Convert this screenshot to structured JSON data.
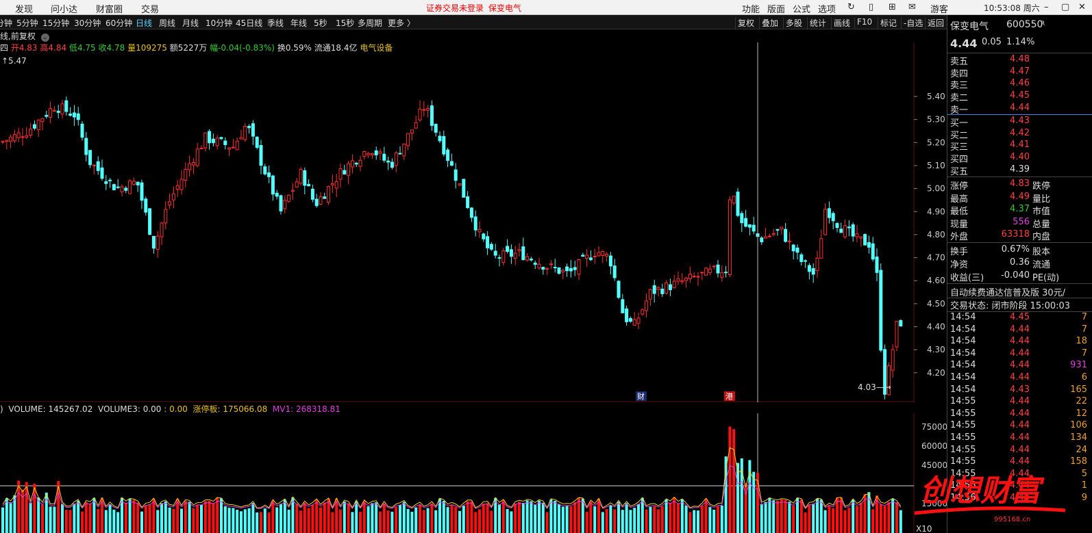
{
  "menu": {
    "left": [
      "发现",
      "问小达",
      "财富圈",
      "交易"
    ],
    "notice": "证券交易未登录",
    "stock_name": "保变电气",
    "right": [
      "功能",
      "版面",
      "公式",
      "选项"
    ],
    "user": "游客",
    "time": "10:53:08 周六"
  },
  "periods": [
    "分钟",
    "5分钟",
    "15分钟",
    "30分钟",
    "60分钟",
    "日线",
    "周线",
    "月线",
    "10分钟",
    "45日线",
    "季线",
    "年线",
    "5秒",
    "15秒",
    "多周期",
    "更多 〉"
  ],
  "active_period": "日线",
  "tools": [
    "复权",
    "叠加",
    "多股",
    "统计",
    "画线",
    "F10",
    "标记",
    "-自选",
    "返回"
  ],
  "info1": "线,前复权",
  "info2": {
    "prefix": "四",
    "open": "开4.83",
    "high": "高4.84",
    "low": "低4.75",
    "close": "收4.78",
    "volume": "量109275",
    "amount": "额5227万",
    "change": "幅-0.04(-0.83%)",
    "turnover": "换0.59%",
    "float": "流通18.4亿",
    "sector": "电气设备"
  },
  "max_label": "5.47",
  "min_label": "4.03",
  "price_axis": [
    "5.40",
    "5.30",
    "5.20",
    "5.10",
    "5.00",
    "4.90",
    "4.80",
    "4.70",
    "4.60",
    "4.50",
    "4.40",
    "4.30",
    "4.20"
  ],
  "markers": {
    "cai": "财",
    "gang": "港"
  },
  "vol_header": {
    "volume": "VOLUME: 145267.02",
    "volume3": "VOLUME3: 0.00",
    "colon": ": 0.00",
    "limit": "涨停板: 175066.08",
    "mv1": "MV1: 268318.81"
  },
  "vol_axis": [
    "75000",
    "60000",
    "45000",
    "15000"
  ],
  "vol_marker": "X10",
  "panel": {
    "name": "保变电气",
    "code": "600550",
    "tag": "R",
    "price": "4.44",
    "chg": "0.05",
    "pct": "1.14%",
    "asks": [
      {
        "label": "卖五",
        "price": "4.48"
      },
      {
        "label": "卖四",
        "price": "4.47"
      },
      {
        "label": "卖三",
        "price": "4.46"
      },
      {
        "label": "卖二",
        "price": "4.45"
      },
      {
        "label": "卖一",
        "price": "4.44"
      }
    ],
    "bids": [
      {
        "label": "买一",
        "price": "4.43"
      },
      {
        "label": "买二",
        "price": "4.42"
      },
      {
        "label": "买三",
        "price": "4.41"
      },
      {
        "label": "买四",
        "price": "4.40"
      },
      {
        "label": "买五",
        "price": "4.39"
      }
    ],
    "stats": [
      {
        "l1": "涨停",
        "v1": "4.83",
        "c": "red",
        "l2": "跌停"
      },
      {
        "l1": "最高",
        "v1": "4.49",
        "c": "red",
        "l2": "量比"
      },
      {
        "l1": "最低",
        "v1": "4.37",
        "c": "green",
        "l2": "市值"
      },
      {
        "l1": "现量",
        "v1": "556",
        "c": "magenta",
        "l2": "总量"
      },
      {
        "l1": "外盘",
        "v1": "63318",
        "c": "red",
        "l2": "内盘"
      }
    ],
    "stats2": [
      {
        "l1": "换手",
        "v1": "0.67%",
        "l2": "股本"
      },
      {
        "l1": "净资",
        "v1": "0.36",
        "l2": "流通"
      },
      {
        "l1": "收益(三)",
        "v1": "-0.040",
        "l2": "PE(动)"
      }
    ],
    "promo": "自动续费通达信普及版  30元/",
    "status": "交易状态: 闭市阶段 15:00:03",
    "ticks": [
      {
        "t": "14:54",
        "p": "4.45",
        "v": "7",
        "pc": "red",
        "vc": "orange"
      },
      {
        "t": "14:54",
        "p": "4.44",
        "v": "7",
        "pc": "red",
        "vc": "orange"
      },
      {
        "t": "14:54",
        "p": "4.44",
        "v": "18",
        "pc": "red",
        "vc": "orange"
      },
      {
        "t": "14:54",
        "p": "4.44",
        "v": "7",
        "pc": "red",
        "vc": "orange"
      },
      {
        "t": "14:54",
        "p": "4.44",
        "v": "931",
        "pc": "red",
        "vc": "magenta"
      },
      {
        "t": "14:54",
        "p": "4.44",
        "v": "6",
        "pc": "red",
        "vc": "orange"
      },
      {
        "t": "14:54",
        "p": "4.43",
        "v": "165",
        "pc": "red",
        "vc": "orange"
      },
      {
        "t": "14:55",
        "p": "4.44",
        "v": "22",
        "pc": "red",
        "vc": "orange"
      },
      {
        "t": "14:55",
        "p": "4.44",
        "v": "12",
        "pc": "red",
        "vc": "orange"
      },
      {
        "t": "14:55",
        "p": "4.44",
        "v": "106",
        "pc": "red",
        "vc": "orange"
      },
      {
        "t": "14:55",
        "p": "4.44",
        "v": "134",
        "pc": "red",
        "vc": "orange"
      },
      {
        "t": "14:55",
        "p": "4.44",
        "v": "24",
        "pc": "red",
        "vc": "orange"
      },
      {
        "t": "14:55",
        "p": "4.44",
        "v": "158",
        "pc": "red",
        "vc": "orange"
      },
      {
        "t": "14:55",
        "p": "4.44",
        "v": "5",
        "pc": "red",
        "vc": "orange"
      },
      {
        "t": "14:56",
        "p": "4.44",
        "v": "1",
        "pc": "red",
        "vc": "orange"
      },
      {
        "t": "14:56",
        "p": "4.45",
        "v": "9",
        "pc": "red",
        "vc": "orange"
      }
    ]
  },
  "watermark": {
    "text": "创想财富",
    "url": "995168.cn"
  },
  "colors": {
    "up": "#ff3030",
    "down": "#54ffff",
    "ma5": "#e8e8e8",
    "ma10": "#f0d020",
    "mv1": "#e040e0"
  }
}
